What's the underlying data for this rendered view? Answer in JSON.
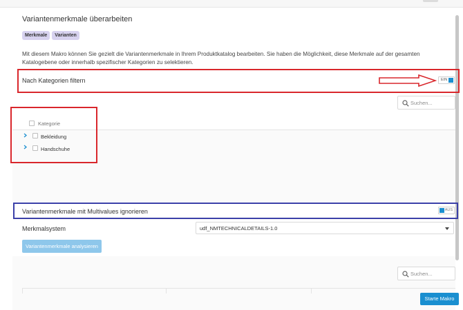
{
  "page": {
    "title": "Variantenmerkmale überarbeiten",
    "tags": [
      "Merkmale",
      "Varianten"
    ],
    "description": "Mit diesem Makro können Sie gezielt die Variantenmerkmale in Ihrem Produktkatalog bearbeiten. Sie haben die Möglichkeit, diese Merkmale auf der gesamten Katalogebene oder innerhalb spezifischer Kategorien zu selektieren."
  },
  "filter": {
    "label": "Nach Kategorien filtern",
    "toggle_text": "EIN",
    "toggle_state": "on"
  },
  "search": {
    "placeholder": "Suchen..."
  },
  "tree": {
    "header": "Kategorie",
    "items": [
      {
        "label": "Bekleidung"
      },
      {
        "label": "Handschuhe"
      }
    ]
  },
  "multivalues": {
    "label": "Variantenmerkmale mit Multivalues ignorieren",
    "toggle_text": "AUS",
    "toggle_state": "off"
  },
  "merkmalsystem": {
    "label": "Merkmalsystem",
    "selected": "udf_NMTECHNICALDETAILS-1.0"
  },
  "buttons": {
    "analyse": "Variantenmerkmale analysieren",
    "start": "Starte Makro"
  },
  "colors": {
    "accent": "#1a8fd0",
    "accent_disabled": "#8ec7eb",
    "tag_bg": "#d7d2ef",
    "annotation_red": "#d9262b",
    "annotation_blue": "#3a3fa8"
  }
}
